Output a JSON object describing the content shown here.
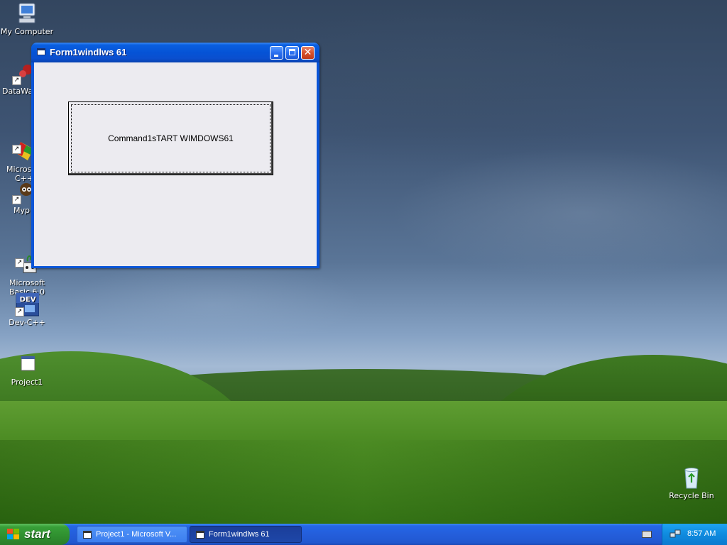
{
  "desktop": {
    "icons": [
      {
        "label": "My Computer"
      },
      {
        "label": "DataWa"
      },
      {
        "label": "Microsoft\nC++"
      },
      {
        "label": "Myp"
      },
      {
        "label": "Microsoft\nBasic 6.0"
      },
      {
        "label": "Dev-C++"
      },
      {
        "label": "Project1"
      },
      {
        "label": "Recycle Bin"
      }
    ]
  },
  "window": {
    "title": "Form1windlws 61",
    "command_button_label": "Command1sTART WIMDOWS61"
  },
  "taskbar": {
    "start_label": "start",
    "tasks": [
      {
        "label": "Project1 - Microsoft V...",
        "active": false
      },
      {
        "label": "Form1windlws 61",
        "active": true
      }
    ],
    "clock": "8:57 AM"
  }
}
